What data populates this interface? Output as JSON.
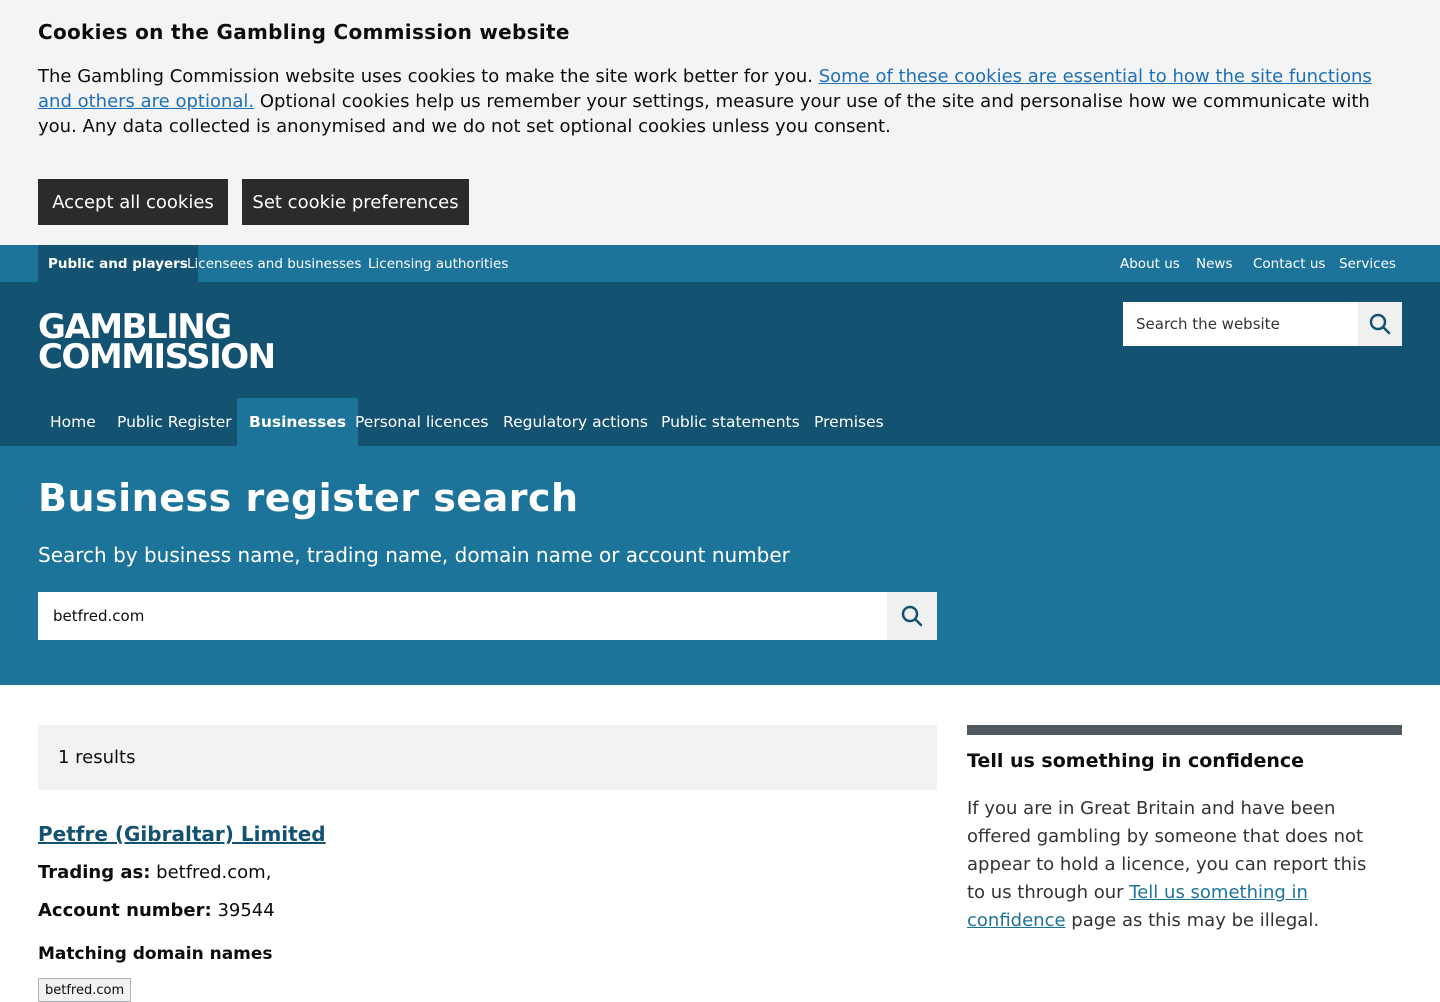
{
  "cookie_banner": {
    "title": "Cookies on the Gambling Commission website",
    "text_intro": "The Gambling Commission website uses cookies to make the site work better for you. ",
    "text_link": "Some of these cookies are essential to how the site functions and others are optional.",
    "text_rest": " Optional cookies help us remember your settings, measure your use of the site and personalise how we communicate with you. Any data collected is anonymised and we do not set optional cookies unless you consent.",
    "accept_label": "Accept all cookies",
    "prefs_label": "Set cookie preferences"
  },
  "audience_nav": {
    "left": [
      "Public and players",
      "Licensees and businesses",
      "Licensing authorities"
    ],
    "right": [
      "About us",
      "News",
      "Contact us",
      "Services"
    ]
  },
  "header": {
    "logo_line1": "GAMBLING",
    "logo_line2": "COMMISSION",
    "search_placeholder": "Search the website",
    "search_icon": "search-icon"
  },
  "main_nav": [
    "Home",
    "Public Register",
    "Businesses",
    "Personal licences",
    "Regulatory actions",
    "Public statements",
    "Premises"
  ],
  "hero": {
    "title": "Business register search",
    "subtitle": "Search by business name, trading name, domain name or account number",
    "search_value": "betfred.com",
    "search_icon": "search-icon"
  },
  "results": {
    "count_label": "1 results",
    "items": [
      {
        "name": "Petfre (Gibraltar) Limited",
        "trading_label": "Trading as:",
        "trading_value": "betfred.com,",
        "account_label": "Account number:",
        "account_value": "39544",
        "domains_label": "Matching domain names",
        "domains": [
          "betfred.com"
        ]
      }
    ]
  },
  "aside": {
    "title": "Tell us something in confidence",
    "text_before": "If you are in Great Britain and have been offered gambling by someone that does not appear to hold a licence, you can report this to us through our ",
    "link": "Tell us something in confidence",
    "text_after": " page as this may be illegal."
  },
  "colors": {
    "audience_bar": "#1d749a",
    "header": "#145271",
    "hero": "#1d749a",
    "button_dark": "#2b2b2b",
    "link": "#1d70b8"
  }
}
